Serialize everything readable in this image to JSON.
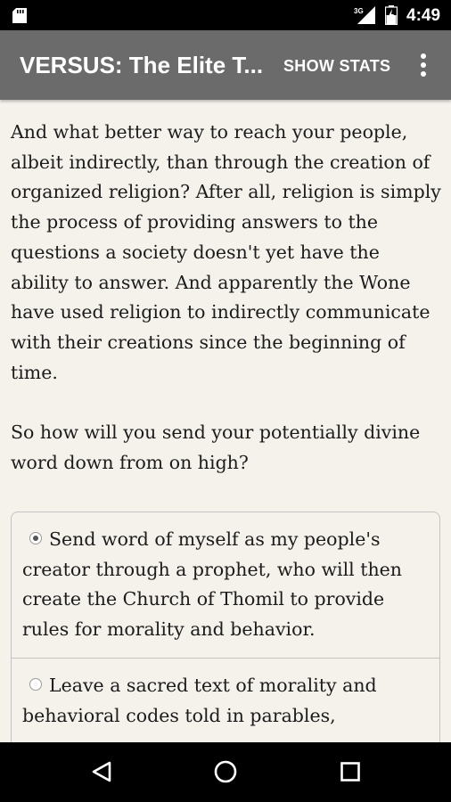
{
  "status_bar": {
    "network": "3G",
    "time": "4:49",
    "icons": [
      "sd-card-icon",
      "signal-icon",
      "battery-icon"
    ]
  },
  "app_bar": {
    "title": "VERSUS: The Elite T...",
    "show_stats_label": "SHOW STATS",
    "overflow_icon": "more-vert-icon"
  },
  "story": {
    "paragraph1": "And what better way to reach your people, albeit indirectly, than through the creation of organized religion? After all, religion is simply the process of providing answers to the questions a society doesn't yet have the ability to answer. And apparently the Wone have used religion to indirectly communicate with their creations since the beginning of time.",
    "paragraph2": "So how will you send your potentially divine word down from on high?"
  },
  "choices": [
    {
      "label": "Send word of myself as my people's creator through a prophet, who will then create the Church of Thomil to provide rules for morality and behavior.",
      "selected": true
    },
    {
      "label": "Leave a sacred text of morality and behavioral codes told in parables,",
      "selected": false
    }
  ],
  "nav_bar": {
    "icons": [
      "back-icon",
      "home-icon",
      "recents-icon"
    ]
  }
}
